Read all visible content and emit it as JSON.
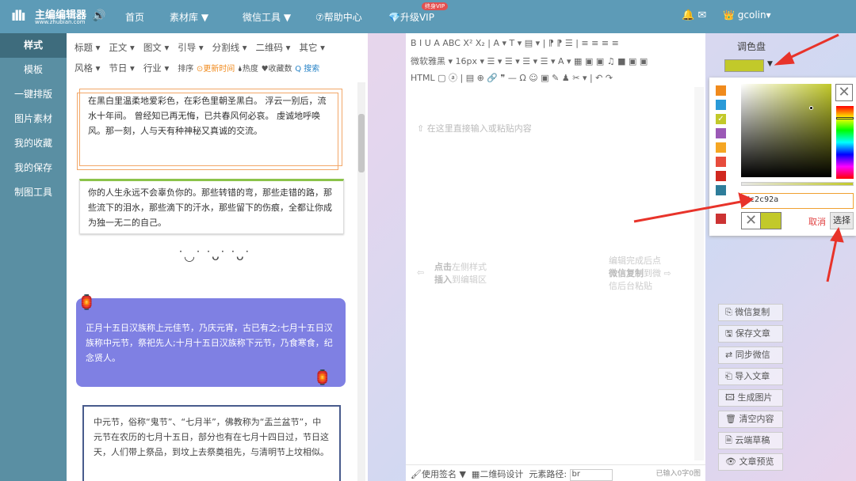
{
  "header": {
    "logo_bars": "ıllı",
    "logo_title": "主编编辑器",
    "logo_url": "www.zhubian.com",
    "nav": [
      {
        "label": "首页"
      },
      {
        "label": "素材库 ▼"
      },
      {
        "label": "微信工具 ▼"
      },
      {
        "label": "⑦帮助中心"
      },
      {
        "label": "💎升级VIP"
      }
    ],
    "vip_badge": "终身VIP",
    "user": "gcolin▾"
  },
  "sidebar": {
    "items": [
      {
        "label": "样式"
      },
      {
        "label": "模板"
      },
      {
        "label": "一键排版"
      },
      {
        "label": "图片素材"
      },
      {
        "label": "我的收藏"
      },
      {
        "label": "我的保存"
      },
      {
        "label": "制图工具"
      }
    ]
  },
  "filters": {
    "row1": [
      "标题 ▾",
      "正文 ▾",
      "图文 ▾",
      "引导 ▾",
      "分割线 ▾",
      "二维码 ▾",
      "其它 ▾"
    ],
    "row2": [
      "风格 ▾",
      "节日 ▾",
      "行业 ▾"
    ],
    "sort_label": "排序",
    "sort_new": "⊙更新时间",
    "sort_hot": "🌢热度",
    "sort_fav": "♥收藏数",
    "search": "Q 搜索"
  },
  "cards": {
    "c1": "在黑白里温柔地爱彩色，在彩色里朝圣黑白。 浮云一别后，流水十年间。 曾经知已再无悔，已共春风何必哀。 虔诚地呼唤风。那一刻，人与天有种神秘又真诚的交流。",
    "c2": "你的人生永远不会辜负你的。那些转错的弯，那些走错的路，那些流下的泪水，那些滴下的汗水，那些留下的伤痕，全都让你成为独一无二的自己。",
    "chicks": "˙◡˙ ˙ᴗ˙ ˙ᴗ˙",
    "c3": "正月十五日汉族称上元佳节，乃庆元宵，古已有之;七月十五日汉族称中元节，祭祀先人;十月十五日汉族称下元节，乃食寒食，纪念贤人。",
    "c4": "中元节，俗称“鬼节”、“七月半”，佛教称为“盂兰盆节”，中元节在农历的七月十五日，部分也有在七月十四日过，节日这天，人们带上祭品，到坟上去祭奠祖先，与清明节上坟相似。"
  },
  "editor": {
    "toolbar1": "B  I  U  A  ABC  X²  X₂  |  A ▾  T ▾  ▤ ▾  |  ⁋  ⁋  ☰  |  ≡  ≡  ≡  ≡",
    "toolbar2": "微软雅黑 ▾  16px ▾  ☰ ▾  ☰ ▾  ☰ ▾  ☰ ▾  A ▾  ▦  ▣  ▣  ♫  ■  ▣  ▣",
    "toolbar3": "HTML  ▢  ⓐ  |  ▤  ⊕  🔗  ❞  —  Ω  ☺  ▣  ✎  ♟  ✂ ▾  |  ↶  ↷",
    "placeholder": "⇧ 在这里直接输入或粘贴内容",
    "hint_left_b1": "点击",
    "hint_left_t1": "左侧样式",
    "hint_left_b2": "插入",
    "hint_left_t2": "到编辑区",
    "hint_right_1": "编辑完成后点",
    "hint_right_b": "微信复制",
    "hint_right_2": "到微",
    "hint_right_3": "信后台粘贴",
    "footer_sign": "🖌使用签名 ▼",
    "footer_qr": "▦二维码设计",
    "footer_path": "元素路径:",
    "footer_path_value": "br",
    "footer_count": "已输入0字0图"
  },
  "palette": {
    "title": "调色盘",
    "current_color": "#c2c92a",
    "dropdown": "▼",
    "swatches": [
      "#f08a1c",
      "#2a9ad8",
      "#c2c92a",
      "#9b59b6",
      "#f5a623",
      "#e74c3c",
      "#d0281f",
      "#2e7d9a",
      "#cc3333"
    ],
    "hex_value": "#c2c92a",
    "cancel": "取消",
    "choose": "选择"
  },
  "actions": [
    {
      "label": "⎘ 微信复制"
    },
    {
      "label": "🖫 保存文章"
    },
    {
      "label": "⇄ 同步微信"
    },
    {
      "label": "⎗ 导入文章"
    },
    {
      "label": "🖾 生成图片"
    },
    {
      "label": "🗑 清空内容"
    },
    {
      "label": "🗎 云端草稿"
    },
    {
      "label": "👁 文章预览"
    }
  ]
}
